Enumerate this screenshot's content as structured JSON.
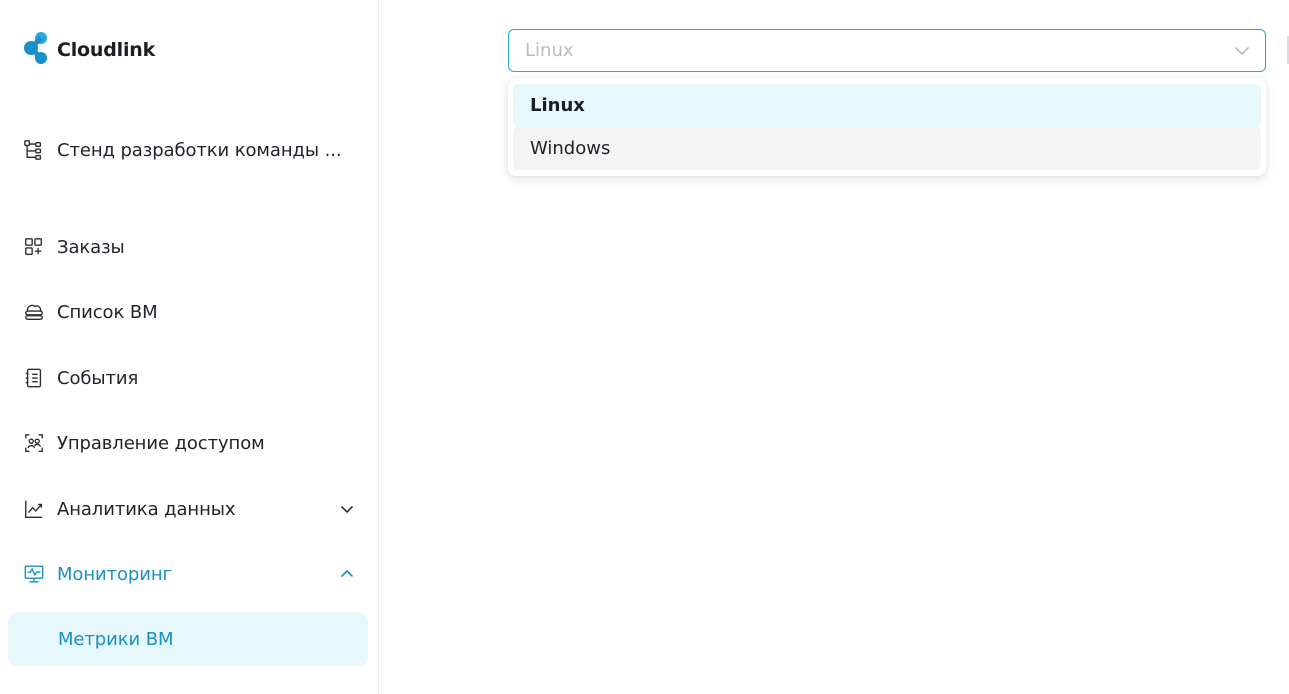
{
  "brand": {
    "name": "Cloudlink",
    "logo_icon": "cloudlink-logo-icon",
    "color": "#1a8fc8"
  },
  "project": {
    "label": "Стенд разработки команды ...",
    "icon": "project-tree-icon"
  },
  "nav": {
    "items": [
      {
        "label": "Заказы",
        "icon": "orders-icon"
      },
      {
        "label": "Список ВМ",
        "icon": "cloud-servers-icon"
      },
      {
        "label": "События",
        "icon": "events-icon"
      },
      {
        "label": "Управление доступом",
        "icon": "access-icon"
      },
      {
        "label": "Аналитика данных",
        "icon": "analytics-icon",
        "expanded": false
      },
      {
        "label": "Мониторинг",
        "icon": "monitoring-icon",
        "expanded": true,
        "active": true
      }
    ],
    "sub_items": [
      {
        "label": "Метрики ВМ",
        "active": true
      }
    ]
  },
  "os_select": {
    "value": "Linux",
    "options": [
      {
        "label": "Linux",
        "selected": true
      },
      {
        "label": "Windows",
        "hovered": true
      }
    ]
  },
  "colors": {
    "accent": "#1a8fc8",
    "active_bg": "#e6f8fc",
    "border_focus": "#2ba7d1",
    "text": "#1f2329",
    "placeholder": "#b8bdc3"
  }
}
